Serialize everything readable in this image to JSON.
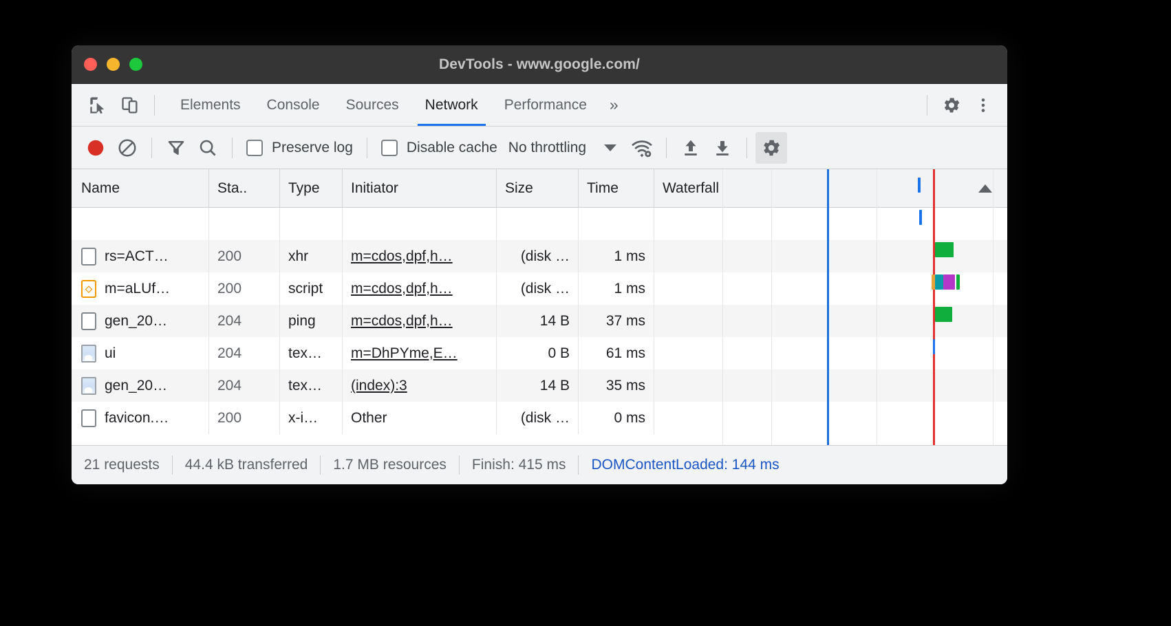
{
  "window": {
    "title": "DevTools - www.google.com/",
    "traffic_lights": [
      "close",
      "minimize",
      "maximize"
    ]
  },
  "tabbar": {
    "left_icons": [
      "inspect-element-icon",
      "device-toolbar-icon"
    ],
    "tabs": [
      {
        "label": "Elements",
        "active": false
      },
      {
        "label": "Console",
        "active": false
      },
      {
        "label": "Sources",
        "active": false
      },
      {
        "label": "Network",
        "active": true
      },
      {
        "label": "Performance",
        "active": false
      }
    ],
    "more_tabs": "»",
    "right_icons": [
      "gear-icon",
      "more-vertical-icon"
    ]
  },
  "toolbar": {
    "record_label": "record-button",
    "clear_label": "clear-button",
    "filter_label": "filter-button",
    "search_label": "search-button",
    "preserve_log": {
      "label": "Preserve log",
      "checked": false
    },
    "disable_cache": {
      "label": "Disable cache",
      "checked": false
    },
    "throttling": {
      "value": "No throttling",
      "caret": "▼"
    },
    "network_conditions_label": "network-conditions-icon",
    "import_label": "import-har-icon",
    "export_label": "export-har-icon",
    "settings_label": "network-settings-icon",
    "settings_pressed": true
  },
  "table": {
    "columns": [
      "Name",
      "Sta..",
      "Type",
      "Initiator",
      "Size",
      "Time",
      "Waterfall"
    ],
    "sort_indicator": "▲",
    "rows": [
      {
        "icon": "document-icon",
        "name": "rs=ACT…",
        "status": "200",
        "type": "xhr",
        "initiator": "m=cdos,dpf,h…",
        "size": "(disk …",
        "time": "1 ms"
      },
      {
        "icon": "script-icon",
        "name": "m=aLUf…",
        "status": "200",
        "type": "script",
        "initiator": "m=cdos,dpf,h…",
        "size": "(disk …",
        "time": "1 ms"
      },
      {
        "icon": "document-icon",
        "name": "gen_20…",
        "status": "204",
        "type": "ping",
        "initiator": "m=cdos,dpf,h…",
        "size": "14 B",
        "time": "37 ms"
      },
      {
        "icon": "image-icon",
        "name": "ui",
        "status": "204",
        "type": "tex…",
        "initiator": "m=DhPYme,E…",
        "size": "0 B",
        "time": "61 ms"
      },
      {
        "icon": "image-icon",
        "name": "gen_20…",
        "status": "204",
        "type": "tex…",
        "initiator": "(index):3",
        "size": "14 B",
        "time": "35 ms"
      },
      {
        "icon": "document-icon",
        "name": "favicon.…",
        "status": "200",
        "type": "x-i…",
        "initiator": "Other",
        "size": "(disk …",
        "time": "0 ms"
      }
    ]
  },
  "waterfall": {
    "markers": [
      {
        "name": "dom-content-loaded-marker",
        "color": "#1a6fdb",
        "x_pct": 36.5
      },
      {
        "name": "load-marker",
        "color": "#e03030",
        "x_pct": 73.8
      }
    ],
    "bars": [
      {
        "row": 0,
        "segments": [
          {
            "color": "#1a73e8",
            "x_pct": 68.5,
            "w_pct": 0.9
          }
        ]
      },
      {
        "row": 1,
        "segments": [
          {
            "color": "#1a73e8",
            "x_pct": 69.0,
            "w_pct": 0.9
          }
        ]
      },
      {
        "row": 2,
        "segments": [
          {
            "color": "#0fae3d",
            "x_pct": 74.5,
            "w_pct": 6.5
          }
        ]
      },
      {
        "row": 3,
        "segments": [
          {
            "color": "#e8a33d",
            "x_pct": 73.4,
            "w_pct": 1.1
          },
          {
            "color": "#0b9ba6",
            "x_pct": 74.5,
            "w_pct": 3.0
          },
          {
            "color": "#b537c9",
            "x_pct": 77.5,
            "w_pct": 4.0
          },
          {
            "color": "#0fae3d",
            "x_pct": 82.0,
            "w_pct": 1.4
          }
        ]
      },
      {
        "row": 4,
        "segments": [
          {
            "color": "#0fae3d",
            "x_pct": 74.6,
            "w_pct": 6.0
          }
        ]
      },
      {
        "row": 5,
        "segments": [
          {
            "color": "#1a73e8",
            "x_pct": 73.9,
            "w_pct": 0.7
          }
        ]
      }
    ],
    "gridline_pcts": [
      17,
      36.5,
      54,
      73.8,
      95
    ]
  },
  "summary": {
    "requests": "21 requests",
    "transferred": "44.4 kB transferred",
    "resources": "1.7 MB resources",
    "finish": "Finish: 415 ms",
    "dom_content_loaded": "DOMContentLoaded: 144 ms",
    "highlight_color": "#1a73e8",
    "dcl_color": "#1a56c4"
  }
}
